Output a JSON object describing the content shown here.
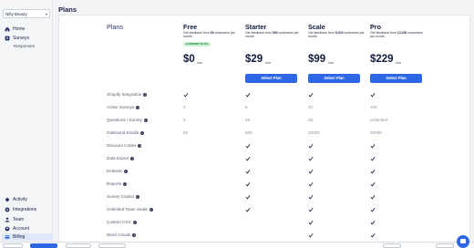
{
  "sidebar": {
    "store": "Nifty Beauty",
    "top_items": [
      {
        "label": "Home",
        "icon": "home-icon"
      },
      {
        "label": "Surveys",
        "icon": "survey-icon"
      }
    ],
    "sub_items": [
      {
        "label": "Responses"
      }
    ],
    "bottom_items": [
      {
        "label": "Activity",
        "icon": "activity-icon"
      },
      {
        "label": "Integrations",
        "icon": "integrations-icon"
      },
      {
        "label": "Team",
        "icon": "team-icon"
      },
      {
        "label": "Account",
        "icon": "account-icon"
      },
      {
        "label": "Billing",
        "icon": "billing-icon",
        "active": true
      }
    ]
  },
  "page": {
    "title": "Plans"
  },
  "pricing": {
    "plans_heading": "Plans",
    "current_label": "CURRENT PLAN",
    "per_label": "/mo",
    "button_label": "Select Plan",
    "plans": [
      {
        "name": "Free",
        "desc_prefix": "Get feedback from ",
        "desc_count": "50",
        "desc_suffix": " customers per month",
        "price": "$0"
      },
      {
        "name": "Starter",
        "desc_prefix": "Get feedback from ",
        "desc_count": "500",
        "desc_suffix": " customers per month",
        "price": "$29"
      },
      {
        "name": "Scale",
        "desc_prefix": "Get feedback from ",
        "desc_count": "5,000",
        "desc_suffix": " customers per month",
        "price": "$99"
      },
      {
        "name": "Pro",
        "desc_prefix": "Get feedback from ",
        "desc_count": "12,000",
        "desc_suffix": " customers per month",
        "price": "$229"
      }
    ],
    "features": [
      {
        "label": "Shopify Integration",
        "values": [
          "check",
          "check",
          "check",
          "check"
        ]
      },
      {
        "label": "Active Surveys",
        "values": [
          "2",
          "5",
          "10",
          "100"
        ]
      },
      {
        "label": "Questions / Survey",
        "values": [
          "3",
          "15",
          "25",
          "Unlimited"
        ]
      },
      {
        "label": "Outbound Emails",
        "values": [
          "50",
          "500",
          "10000",
          "30000"
        ]
      },
      {
        "label": "Discount Codes",
        "values": [
          "",
          "check",
          "check",
          "check"
        ]
      },
      {
        "label": "Data Export",
        "values": [
          "",
          "check",
          "check",
          "check"
        ]
      },
      {
        "label": "Embeds",
        "values": [
          "",
          "check",
          "check",
          "check"
        ]
      },
      {
        "label": "Reports",
        "values": [
          "",
          "check",
          "check",
          "check"
        ]
      },
      {
        "label": "Survey Copilot",
        "values": [
          "",
          "check",
          "check",
          "check"
        ]
      },
      {
        "label": "Unlimited Team Seats",
        "values": [
          "",
          "check",
          "check",
          "check"
        ]
      },
      {
        "label": "Custom CSS",
        "values": [
          "",
          "",
          "check",
          "check"
        ]
      },
      {
        "label": "Word Clouds",
        "values": [
          "",
          "",
          "check",
          "check"
        ]
      }
    ]
  },
  "colors": {
    "accent": "#2d67e8",
    "current_badge_bg": "#c9f2d3",
    "current_badge_text": "#1f7a3a"
  }
}
